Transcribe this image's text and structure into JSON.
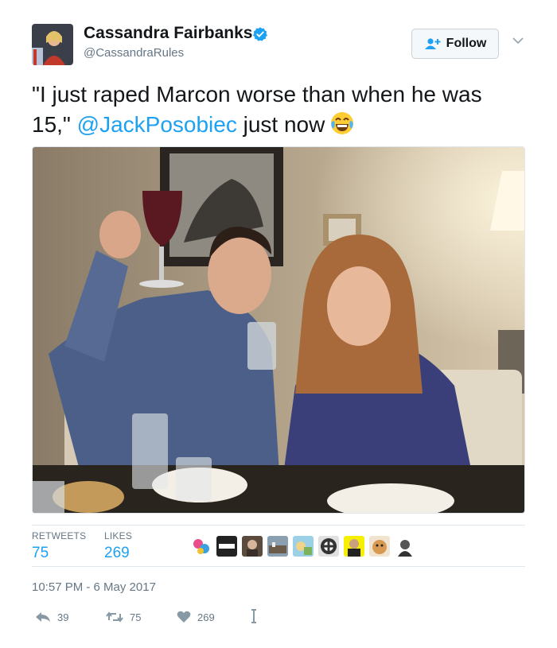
{
  "user": {
    "display_name": "Cassandra Fairbanks",
    "handle": "@CassandraRules",
    "verified": true,
    "avatar_icon": "avatar-photo"
  },
  "follow_label": "Follow",
  "tweet": {
    "text_before": "\"I just raped Marcon worse than when he was 15,\" ",
    "mention": "@JackPosobiec",
    "text_after": " just now",
    "emoji": "face-with-tears-of-joy"
  },
  "stats": {
    "retweets_label": "RETWEETS",
    "retweets": "75",
    "likes_label": "LIKES",
    "likes": "269"
  },
  "timestamp": "10:57 PM - 6 May 2017",
  "actions": {
    "reply_count": "39",
    "retweet_count": "75",
    "like_count": "269"
  },
  "colors": {
    "link": "#1da1f2",
    "muted": "#657786",
    "verified": "#1da1f2"
  }
}
